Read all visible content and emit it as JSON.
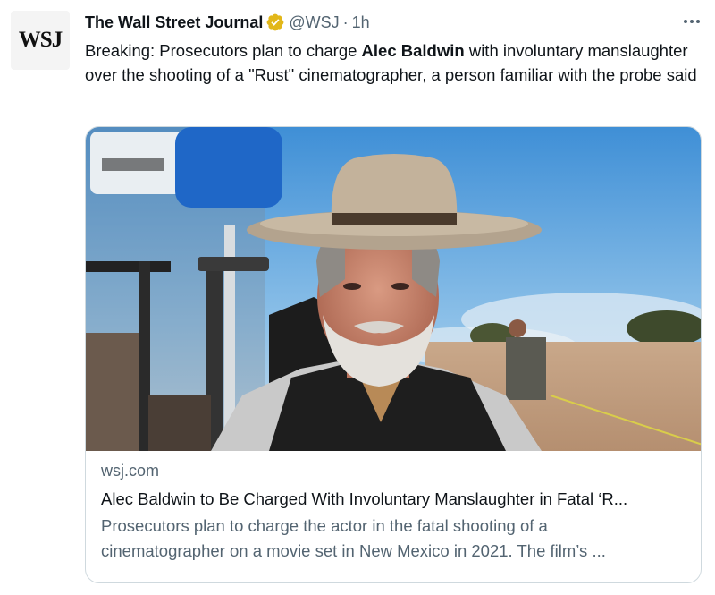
{
  "tweet": {
    "avatar_text": "WSJ",
    "display_name": "The Wall Street Journal",
    "handle": "@WSJ",
    "separator": "·",
    "time": "1h",
    "verified_badge_color": "#e2b719",
    "text_before": "Breaking: Prosecutors plan to charge ",
    "text_bold": "Alec Baldwin",
    "text_after": " with involuntary manslaughter over the shooting of a \"Rust\" cinematographer, a person familiar with the probe said"
  },
  "card": {
    "domain": "wsj.com",
    "title": "Alec Baldwin to Be Charged With Involuntary Manslaughter in Fatal ‘R...",
    "description": "Prosecutors plan to charge the actor in the fatal shooting of a cinematographer on a movie set in New Mexico in 2021. The film’s ...",
    "image_subject": "man-in-cowboy-hat-on-film-set"
  },
  "colors": {
    "text_primary": "#0f1419",
    "text_secondary": "#536471",
    "card_border": "#cfd9de",
    "verified": "#e2b719"
  },
  "icons": {
    "verified": "verified-badge-icon",
    "more": "more-options-icon"
  }
}
